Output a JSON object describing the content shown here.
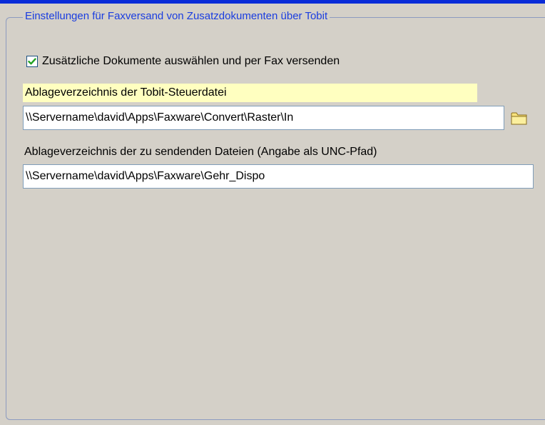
{
  "group": {
    "title": "Einstellungen für Faxversand von Zusatzdokumenten über Tobit"
  },
  "checkbox": {
    "label": "Zusätzliche Dokumente auswählen und per Fax versenden",
    "checked": true
  },
  "control_path": {
    "label": "Ablageverzeichnis der Tobit-Steuerdatei",
    "value": "\\\\Servername\\david\\Apps\\Faxware\\Convert\\Raster\\In",
    "browse_icon": "folder-icon"
  },
  "send_path": {
    "label": "Ablageverzeichnis der zu sendenden Dateien (Angabe als UNC-Pfad)",
    "value": "\\\\Servername\\david\\Apps\\Faxware\\Gehr_Dispo"
  },
  "colors": {
    "title_text": "#1a3de0",
    "top_bar": "#0a2cd8",
    "highlight_label": "#ffffc0",
    "background": "#d4d0c8",
    "checkmark": "#21a121"
  }
}
